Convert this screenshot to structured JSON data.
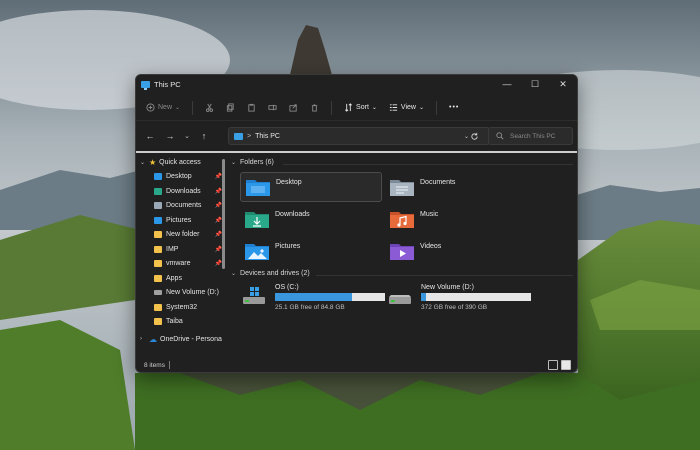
{
  "window": {
    "title": "This PC",
    "controls": {
      "minimize": "—",
      "maximize": "☐",
      "close": "✕"
    }
  },
  "toolbar": {
    "new_label": "New",
    "sort_label": "Sort",
    "view_label": "View",
    "more_label": "•••"
  },
  "navigation": {
    "back": "←",
    "forward": "→",
    "history": "⌄",
    "up": "↑",
    "address_separator": ">",
    "address_text": "This PC",
    "search_placeholder": "Search This PC"
  },
  "sidebar": {
    "items": [
      {
        "label": "Quick access",
        "icon": "star-icon",
        "color": "#f3c23a",
        "expanded": true
      },
      {
        "label": "Desktop",
        "icon": "desktop-folder-icon",
        "color": "#2b97e8",
        "pinned": true
      },
      {
        "label": "Downloads",
        "icon": "downloads-folder-icon",
        "color": "#2aa88a",
        "pinned": true
      },
      {
        "label": "Documents",
        "icon": "documents-folder-icon",
        "color": "#9aa7b5",
        "pinned": true
      },
      {
        "label": "Pictures",
        "icon": "pictures-folder-icon",
        "color": "#2b97e8",
        "pinned": true
      },
      {
        "label": "New folder",
        "icon": "folder-icon",
        "color": "#f2c24d",
        "pinned": true
      },
      {
        "label": "IMP",
        "icon": "folder-icon",
        "color": "#f2c24d",
        "pinned": true
      },
      {
        "label": "vmware",
        "icon": "folder-icon",
        "color": "#f2c24d",
        "pinned": true
      },
      {
        "label": "Apps",
        "icon": "folder-icon",
        "color": "#f2c24d",
        "pinned": false
      },
      {
        "label": "New Volume (D:)",
        "icon": "drive-icon",
        "color": "#a0a0a0",
        "pinned": false
      },
      {
        "label": "System32",
        "icon": "folder-icon",
        "color": "#f2c24d",
        "pinned": false
      },
      {
        "label": "Taiba",
        "icon": "folder-icon",
        "color": "#f2c24d",
        "pinned": false
      },
      {
        "label": "OneDrive - Persona",
        "icon": "onedrive-icon",
        "color": "#2b88d8",
        "expanded": false
      }
    ]
  },
  "main": {
    "folders_header": "Folders (6)",
    "folders": [
      {
        "name": "Desktop",
        "icon": "desktop-folder-icon",
        "color": "#2b97e8",
        "selected": true
      },
      {
        "name": "Documents",
        "icon": "documents-folder-icon",
        "color": "#9aa7b5",
        "selected": false
      },
      {
        "name": "Downloads",
        "icon": "downloads-folder-icon",
        "color": "#2aa88a",
        "selected": false
      },
      {
        "name": "Music",
        "icon": "music-folder-icon",
        "color": "#e66a3a",
        "selected": false
      },
      {
        "name": "Pictures",
        "icon": "pictures-folder-icon",
        "color": "#2b97e8",
        "selected": false
      },
      {
        "name": "Videos",
        "icon": "videos-folder-icon",
        "color": "#8b5bd6",
        "selected": false
      }
    ],
    "drives_header": "Devices and drives (2)",
    "drives": [
      {
        "name": "OS (C:)",
        "free_text": "25.1 GB free of 84.8 GB",
        "used_fraction": 0.704,
        "icon": "windows-drive-icon"
      },
      {
        "name": "New Volume (D:)",
        "free_text": "372 GB free of 390 GB",
        "used_fraction": 0.046,
        "icon": "drive-icon"
      }
    ]
  },
  "status": {
    "items_text": "8 items"
  },
  "colors": {
    "accent": "#3a96dd",
    "window_bg": "#202020"
  }
}
